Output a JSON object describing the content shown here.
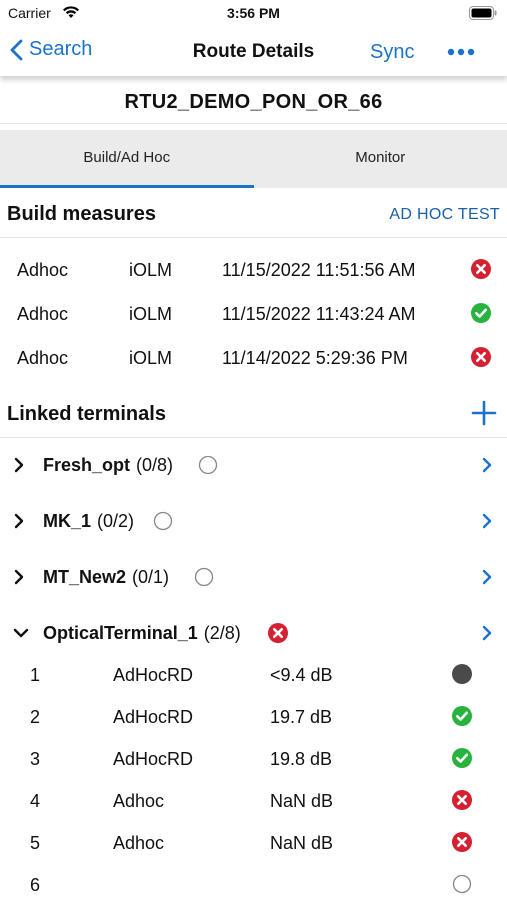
{
  "status_bar": {
    "carrier": "Carrier",
    "time": "3:56 PM"
  },
  "nav": {
    "back_label": "Search",
    "title": "Route Details",
    "sync_label": "Sync"
  },
  "route_name": "RTU2_DEMO_PON_OR_66",
  "tabs": [
    {
      "label": "Build/Ad Hoc",
      "active": true
    },
    {
      "label": "Monitor",
      "active": false
    }
  ],
  "build": {
    "title": "Build measures",
    "action": "AD HOC TEST",
    "rows": [
      {
        "type": "Adhoc",
        "tool": "iOLM",
        "date": "11/15/2022 11:51:56 AM",
        "status": "fail"
      },
      {
        "type": "Adhoc",
        "tool": "iOLM",
        "date": "11/15/2022 11:43:24 AM",
        "status": "pass"
      },
      {
        "type": "Adhoc",
        "tool": "iOLM",
        "date": "11/14/2022 5:29:36 PM",
        "status": "fail"
      }
    ]
  },
  "linked": {
    "title": "Linked terminals",
    "terminals": [
      {
        "name": "Fresh_opt",
        "count": "(0/8)",
        "status": "empty",
        "expanded": false
      },
      {
        "name": "MK_1",
        "count": "(0/2)",
        "status": "empty",
        "expanded": false
      },
      {
        "name": "MT_New2",
        "count": "(0/1)",
        "status": "empty",
        "expanded": false
      },
      {
        "name": "OpticalTerminal_1",
        "count": "(2/8)",
        "status": "fail",
        "expanded": true
      }
    ],
    "fibers": [
      {
        "num": "1",
        "type": "AdHocRD",
        "value": "<9.4 dB",
        "status": "unknown"
      },
      {
        "num": "2",
        "type": "AdHocRD",
        "value": "19.7 dB",
        "status": "pass"
      },
      {
        "num": "3",
        "type": "AdHocRD",
        "value": "19.8 dB",
        "status": "pass"
      },
      {
        "num": "4",
        "type": "Adhoc",
        "value": "NaN dB",
        "status": "fail"
      },
      {
        "num": "5",
        "type": "Adhoc",
        "value": "NaN dB",
        "status": "fail"
      },
      {
        "num": "6",
        "type": "",
        "value": "",
        "status": "empty"
      }
    ]
  },
  "colors": {
    "accent": "#1a73c8",
    "pass": "#27b33e",
    "fail": "#d42030",
    "unknown": "#4a4a4a"
  }
}
